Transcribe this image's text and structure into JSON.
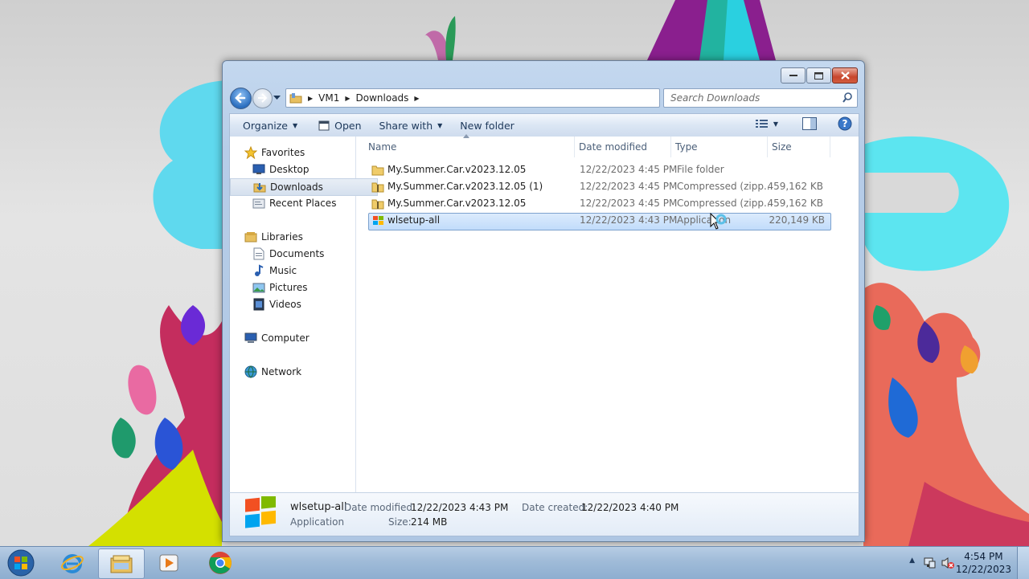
{
  "window": {
    "address": {
      "crumbs": [
        "VM1",
        "Downloads"
      ]
    },
    "search": {
      "placeholder": "Search Downloads"
    },
    "toolbar": {
      "organize": "Organize",
      "open": "Open",
      "share_with": "Share with",
      "new_folder": "New folder"
    },
    "nav_pane": {
      "favorites": "Favorites",
      "desktop": "Desktop",
      "downloads": "Downloads",
      "recent_places": "Recent Places",
      "libraries": "Libraries",
      "documents": "Documents",
      "music": "Music",
      "pictures": "Pictures",
      "videos": "Videos",
      "computer": "Computer",
      "network": "Network",
      "selected": "Downloads"
    },
    "columns": {
      "name": "Name",
      "date_modified": "Date modified",
      "type": "Type",
      "size": "Size"
    },
    "files": [
      {
        "name": "My.Summer.Car.v2023.12.05",
        "date": "12/22/2023 4:45 PM",
        "type": "File folder",
        "size": "",
        "icon": "folder-icon"
      },
      {
        "name": "My.Summer.Car.v2023.12.05 (1)",
        "date": "12/22/2023 4:45 PM",
        "type": "Compressed (zipp...",
        "size": "459,162 KB",
        "icon": "zip-folder-icon"
      },
      {
        "name": "My.Summer.Car.v2023.12.05",
        "date": "12/22/2023 4:45 PM",
        "type": "Compressed (zipp...",
        "size": "459,162 KB",
        "icon": "zip-folder-icon"
      },
      {
        "name": "wlsetup-all",
        "date": "12/22/2023 4:43 PM",
        "type": "Application",
        "size": "220,149 KB",
        "icon": "windows-installer-icon",
        "selected": true
      }
    ],
    "details": {
      "name": "wlsetup-all",
      "kind": "Application",
      "date_modified_label": "Date modified:",
      "date_modified": "12/22/2023 4:43 PM",
      "date_created_label": "Date created:",
      "date_created": "12/22/2023 4:40 PM",
      "size_label": "Size:",
      "size": "214 MB"
    }
  },
  "taskbar": {
    "clock_time": "4:54 PM",
    "clock_date": "12/22/2023"
  },
  "colors": {
    "selection": "#cce4fb",
    "window_frame": "#b6cde8",
    "taskbar": "#9fbbd8"
  }
}
